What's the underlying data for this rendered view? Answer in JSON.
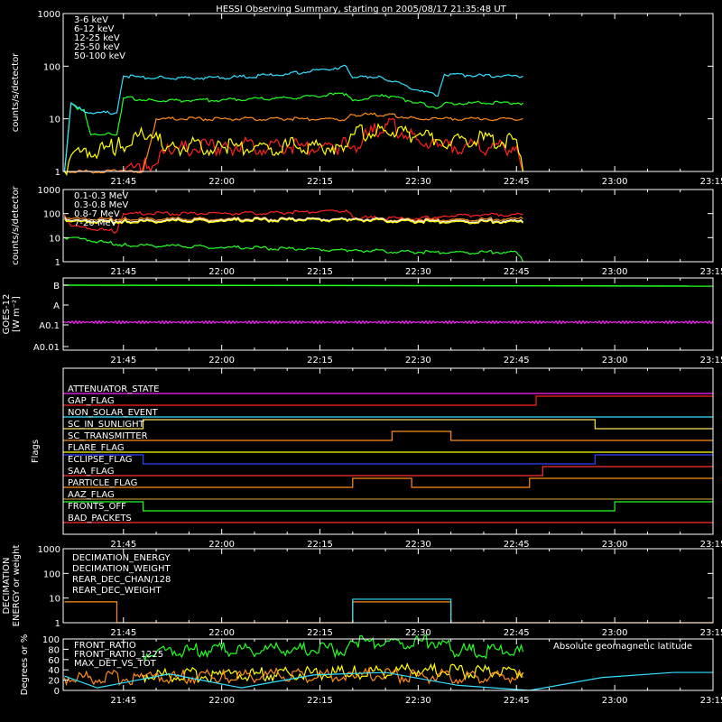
{
  "title": "HESSI Observing Summary, starting on 2005/08/17 21:35:48 UT",
  "time_axis": {
    "tick_labels": [
      "21:45",
      "22:00",
      "22:15",
      "22:30",
      "22:45",
      "23:00",
      "23:15"
    ],
    "start": "21:35:48",
    "end": "23:15"
  },
  "chart_data": [
    {
      "type": "line",
      "id": "low_energy",
      "ylabel": "counts/s/detector",
      "yscale": "log",
      "ylim": [
        1,
        1000
      ],
      "ytick_labels": [
        "1",
        "10",
        "100",
        "1000"
      ],
      "legend_placement": "top-left",
      "series": [
        {
          "name": "3-6 keV",
          "color": "#ff2020",
          "style": "dense",
          "x": [
            "21:44:30",
            "21:45",
            "21:48",
            "21:52",
            "22:00",
            "22:10",
            "22:18",
            "22:20",
            "22:25",
            "22:30",
            "22:33",
            "22:45",
            "22:46"
          ],
          "y": [
            1,
            1,
            1.2,
            2.5,
            3,
            3,
            3,
            3,
            8,
            4,
            3,
            3,
            1
          ]
        },
        {
          "name": "6-12 keV",
          "color": "#ff8c1a",
          "style": "line",
          "x": [
            "21:36",
            "21:44",
            "21:48",
            "21:50",
            "22:00",
            "22:10",
            "22:19",
            "22:20",
            "22:25",
            "22:30",
            "22:33",
            "22:40",
            "22:46"
          ],
          "y": [
            1,
            1,
            1,
            10,
            10,
            10,
            10,
            12,
            12,
            10,
            10,
            10,
            10
          ]
        },
        {
          "name": "12-25 keV",
          "color": "#ffff00",
          "style": "dense",
          "x": [
            "21:36",
            "21:37",
            "21:44",
            "21:48",
            "21:52",
            "22:00",
            "22:10",
            "22:18",
            "22:20",
            "22:25",
            "22:30",
            "22:33",
            "22:45",
            "22:46"
          ],
          "y": [
            1,
            2,
            3,
            5,
            3,
            3,
            3,
            3,
            5,
            6,
            5,
            4,
            4,
            1
          ]
        },
        {
          "name": "25-50 keV",
          "color": "#22ff22",
          "style": "line",
          "x": [
            "21:36",
            "21:37",
            "21:38",
            "21:39",
            "21:40",
            "21:41",
            "21:42",
            "21:44",
            "21:45",
            "21:50",
            "22:00",
            "22:10",
            "22:19",
            "22:20",
            "22:25",
            "22:30",
            "22:33",
            "22:34",
            "22:40",
            "22:46"
          ],
          "y": [
            1,
            20,
            15,
            15,
            5,
            5,
            5,
            5,
            25,
            22,
            23,
            25,
            30,
            22,
            28,
            20,
            16,
            20,
            20,
            20
          ]
        },
        {
          "name": "50-100 keV",
          "color": "#33e0ff",
          "style": "line",
          "x": [
            "21:36",
            "21:37",
            "21:38",
            "21:40",
            "21:44",
            "21:45",
            "21:50",
            "22:00",
            "22:10",
            "22:19",
            "22:20",
            "22:24",
            "22:30",
            "22:33",
            "22:34",
            "22:40",
            "22:46"
          ],
          "y": [
            1,
            20,
            16,
            13,
            13,
            65,
            60,
            60,
            70,
            100,
            60,
            65,
            35,
            27,
            70,
            65,
            65
          ]
        }
      ]
    },
    {
      "type": "line",
      "id": "high_energy",
      "ylabel": "counts/s/detector",
      "yscale": "log",
      "ylim": [
        1,
        1000
      ],
      "ytick_labels": [
        "1",
        "10",
        "100",
        "1000"
      ],
      "legend_placement": "top-left",
      "series": [
        {
          "name": "0.1-0.3 MeV",
          "color": "#ff2020",
          "x": [
            "21:36",
            "21:37",
            "21:44",
            "21:45",
            "22:00",
            "22:10",
            "22:19",
            "22:20",
            "22:30",
            "22:34",
            "22:40",
            "22:46"
          ],
          "y": [
            90,
            30,
            18,
            100,
            100,
            110,
            140,
            70,
            60,
            80,
            90,
            90
          ]
        },
        {
          "name": "0.3-0.8 MeV",
          "color": "#ff8c1a",
          "x": [
            "21:36",
            "21:37",
            "21:45",
            "22:00",
            "22:20",
            "22:30",
            "22:45",
            "22:46"
          ],
          "y": [
            80,
            60,
            60,
            60,
            60,
            55,
            60,
            60
          ]
        },
        {
          "name": "0.8-7 MeV",
          "color": "#ffffff",
          "x": [
            "21:36",
            "21:37",
            "21:45",
            "22:00",
            "22:20",
            "22:30",
            "22:45",
            "22:46"
          ],
          "y": [
            70,
            50,
            50,
            55,
            60,
            50,
            50,
            45
          ]
        },
        {
          "name": "7-20 MeV",
          "color": "#ffff00",
          "x": [
            "21:36",
            "21:37",
            "21:45",
            "22:00",
            "22:20",
            "22:30",
            "22:45",
            "22:46"
          ],
          "y": [
            60,
            45,
            45,
            50,
            55,
            45,
            45,
            40
          ]
        },
        {
          "name": "",
          "color": "#22ff22",
          "x": [
            "21:36",
            "21:37",
            "21:45",
            "22:00",
            "22:20",
            "22:30",
            "22:45",
            "22:46"
          ],
          "y": [
            10,
            10,
            5,
            4,
            3,
            2.5,
            2.5,
            1
          ]
        }
      ]
    },
    {
      "type": "line",
      "id": "goes",
      "ylabel": "GOES-12",
      "ylabel_sub": "[W m⁻²]",
      "ylim_labels": [
        "A0.01",
        "A0.1",
        "A",
        "B"
      ],
      "series": [
        {
          "name": "",
          "color": "#22ff22",
          "x": [
            "21:36",
            "23:15"
          ],
          "level": "B"
        },
        {
          "name": "",
          "color": "#ff20ff",
          "x": [
            "21:36",
            "23:15"
          ],
          "level": "A0.1+"
        }
      ]
    },
    {
      "type": "step",
      "id": "flags",
      "ylabel": "Flags",
      "flags": [
        {
          "name": "ATTENUATOR_STATE",
          "color": "#ff20ff",
          "steps": [
            [
              "21:36",
              0
            ]
          ]
        },
        {
          "name": "GAP_FLAG",
          "color": "#ff2020",
          "steps": [
            [
              "21:36",
              0
            ],
            [
              "22:48",
              1
            ]
          ]
        },
        {
          "name": "NON_SOLAR_EVENT",
          "color": "#33e0ff",
          "steps": [
            [
              "21:36",
              0
            ]
          ]
        },
        {
          "name": "SC_IN_SUNLIGHT",
          "color": "#ffe060",
          "steps": [
            [
              "21:36",
              0
            ],
            [
              "21:48",
              1
            ],
            [
              "22:57",
              0
            ]
          ]
        },
        {
          "name": "SC_TRANSMITTER",
          "color": "#ff8c1a",
          "steps": [
            [
              "21:36",
              0
            ],
            [
              "22:26",
              1
            ],
            [
              "22:35",
              0
            ]
          ]
        },
        {
          "name": "FLARE_FLAG",
          "color": "#ffff00",
          "steps": [
            [
              "21:36",
              0
            ]
          ]
        },
        {
          "name": "ECLIPSE_FLAG",
          "color": "#3040ff",
          "steps": [
            [
              "21:36",
              1
            ],
            [
              "21:48",
              0
            ],
            [
              "22:57",
              1
            ]
          ]
        },
        {
          "name": "SAA_FLAG",
          "color": "#ff3030",
          "steps": [
            [
              "21:36",
              0
            ],
            [
              "22:49",
              1
            ]
          ]
        },
        {
          "name": "PARTICLE_FLAG",
          "color": "#ff8c1a",
          "steps": [
            [
              "21:36",
              0
            ],
            [
              "22:20",
              1
            ],
            [
              "22:29",
              0
            ],
            [
              "22:47",
              1
            ]
          ]
        },
        {
          "name": "AAZ_FLAG",
          "color": "#b08830",
          "steps": [
            [
              "21:36",
              0
            ]
          ]
        },
        {
          "name": "FRONTS_OFF",
          "color": "#22ff22",
          "steps": [
            [
              "21:36",
              1
            ],
            [
              "21:48",
              0
            ],
            [
              "23:00",
              1
            ]
          ]
        },
        {
          "name": "BAD_PACKETS",
          "color": "#ff3030",
          "steps": [
            [
              "21:36",
              0
            ]
          ]
        }
      ]
    },
    {
      "type": "step",
      "id": "decimation",
      "ylabel": "DECIMATION",
      "ylabel_sub": "ENERGY or weight",
      "yscale": "log",
      "ylim": [
        1,
        1000
      ],
      "ytick_labels": [
        "1",
        "10",
        "100",
        "1000"
      ],
      "series": [
        {
          "name": "DECIMATION_ENERGY",
          "color": "#22ff22",
          "values": []
        },
        {
          "name": "DECIMATION_WEIGHT",
          "color": "#ff8c1a",
          "x": [
            "21:36",
            "21:44",
            "21:44",
            "22:20",
            "22:20",
            "22:35",
            "22:35",
            "23:15"
          ],
          "y": [
            7,
            7,
            1,
            1,
            7,
            7,
            1,
            1
          ]
        },
        {
          "name": "REAR_DEC_CHAN/128",
          "color": "#33e0ff",
          "x": [
            "22:20",
            "22:20",
            "22:35",
            "22:35"
          ],
          "y": [
            1,
            9,
            9,
            1
          ]
        },
        {
          "name": "REAR_DEC_WEIGHT",
          "color": "#b08830",
          "values": []
        }
      ]
    },
    {
      "type": "line",
      "id": "ratios",
      "ylabel": "Degrees or %",
      "ylim": [
        0,
        100
      ],
      "ytick_labels": [
        "0",
        "20",
        "40",
        "60",
        "80",
        "100"
      ],
      "annotation": "Absolute geomagnetic latitude",
      "series": [
        {
          "name": "FRONT_RATIO",
          "color": "#22ff22",
          "x": [
            "21:48",
            "21:50",
            "22:00",
            "22:10",
            "22:19",
            "22:20",
            "22:34",
            "22:35",
            "22:46"
          ],
          "y": [
            70,
            75,
            80,
            78,
            80,
            95,
            95,
            78,
            75
          ]
        },
        {
          "name": "FRONT_RATIO_1225",
          "color": "#ffff00",
          "x": [
            "21:48",
            "22:00",
            "22:20",
            "22:30",
            "22:46"
          ],
          "y": [
            30,
            30,
            35,
            38,
            35
          ]
        },
        {
          "name": "MAX_DET_VS_TOT",
          "color": "#ff8c1a",
          "x": [
            "21:36",
            "21:48",
            "22:00",
            "22:20",
            "22:30",
            "22:46"
          ],
          "y": [
            25,
            25,
            28,
            30,
            28,
            25
          ]
        },
        {
          "name": "",
          "color": "#33e0ff",
          "x": [
            "21:36",
            "21:41",
            "21:52",
            "22:03",
            "22:14",
            "22:25",
            "22:36",
            "22:47",
            "22:58",
            "23:09",
            "23:15"
          ],
          "y": [
            28,
            5,
            32,
            5,
            30,
            35,
            10,
            0,
            25,
            35,
            35
          ]
        }
      ]
    }
  ]
}
